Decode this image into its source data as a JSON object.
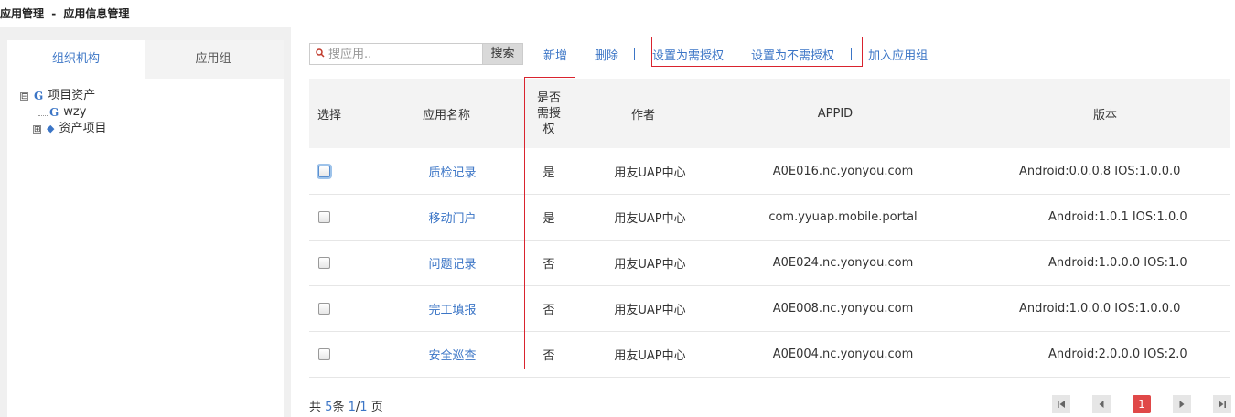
{
  "breadcrumb": {
    "module": "应用管理",
    "separator": "-",
    "page": "应用信息管理"
  },
  "left_tabs": [
    {
      "label": "组织机构"
    },
    {
      "label": "应用组"
    }
  ],
  "tree": {
    "root": {
      "label": "项目资产",
      "icon": "G",
      "expander": "⊟"
    },
    "child": {
      "label": "wzy",
      "icon": "G"
    },
    "group": {
      "label": "资产项目",
      "expander": "⊞"
    }
  },
  "toolbar": {
    "search_placeholder": "搜应用..",
    "search_button": "搜索",
    "add": "新增",
    "delete": "删除",
    "set_auth": "设置为需授权",
    "set_noauth": "设置为不需授权",
    "add_to_group": "加入应用组"
  },
  "table": {
    "headers": {
      "select": "选择",
      "name": "应用名称",
      "auth_line1": "是否",
      "auth_line2": "需授",
      "auth_line3": "权",
      "author": "作者",
      "appid": "APPID",
      "version": "版本"
    },
    "rows": [
      {
        "name": "质检记录",
        "auth": "是",
        "author": "用友UAP中心",
        "appid": "A0E016.nc.yonyou.com",
        "version": "Android:0.0.0.8 IOS:1.0.0.0"
      },
      {
        "name": "移动门户",
        "auth": "是",
        "author": "用友UAP中心",
        "appid": "com.yyuap.mobile.portal",
        "version": "Android:1.0.1 IOS:1.0.0"
      },
      {
        "name": "问题记录",
        "auth": "否",
        "author": "用友UAP中心",
        "appid": "A0E024.nc.yonyou.com",
        "version": "Android:1.0.0.0 IOS:1.0"
      },
      {
        "name": "完工填报",
        "auth": "否",
        "author": "用友UAP中心",
        "appid": "A0E008.nc.yonyou.com",
        "version": "Android:1.0.0.0 IOS:1.0.0.0"
      },
      {
        "name": "安全巡查",
        "auth": "否",
        "author": "用友UAP中心",
        "appid": "A0E004.nc.yonyou.com",
        "version": "Android:2.0.0.0 IOS:2.0"
      }
    ]
  },
  "footer": {
    "prefix": "共",
    "total": "5",
    "unit": "条",
    "page": "1",
    "slash": "/",
    "pages": "1",
    "page_unit": "页"
  },
  "pager": {
    "current": "1"
  },
  "colors": {
    "accent": "#3b75c6",
    "highlight": "#d9232e",
    "pager_active": "#e04848"
  }
}
